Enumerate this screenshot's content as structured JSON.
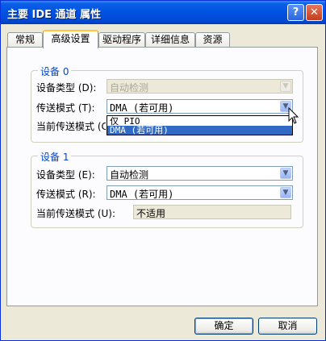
{
  "window": {
    "title": "主要 IDE 通道 属性",
    "help_glyph": "?",
    "close_glyph": "✕"
  },
  "tabs": [
    "常规",
    "高级设置",
    "驱动程序",
    "详细信息",
    "资源"
  ],
  "active_tab": 1,
  "device0": {
    "title": "设备 0",
    "device_type_label": "设备类型 (D):",
    "device_type_value": "自动检测",
    "device_type_disabled": true,
    "transfer_mode_label": "传送模式 (T):",
    "transfer_mode_value": "DMA (若可用)",
    "current_mode_label": "当前传送模式 (C):",
    "dropdown_options": [
      "仅 PIO",
      "DMA (若可用)"
    ],
    "dropdown_selected": 1
  },
  "device1": {
    "title": "设备 1",
    "device_type_label": "设备类型 (E):",
    "device_type_value": "自动检测",
    "transfer_mode_label": "传送模式 (R):",
    "transfer_mode_value": "DMA (若可用)",
    "current_mode_label": "当前传送模式 (U):",
    "current_mode_value": "不适用"
  },
  "buttons": {
    "ok": "确定",
    "cancel": "取消"
  },
  "icons": {
    "dropdown_arrow": "▼"
  },
  "colors": {
    "title_blue": "#0054e3",
    "group_title": "#0046d5",
    "selection": "#316ac5"
  }
}
